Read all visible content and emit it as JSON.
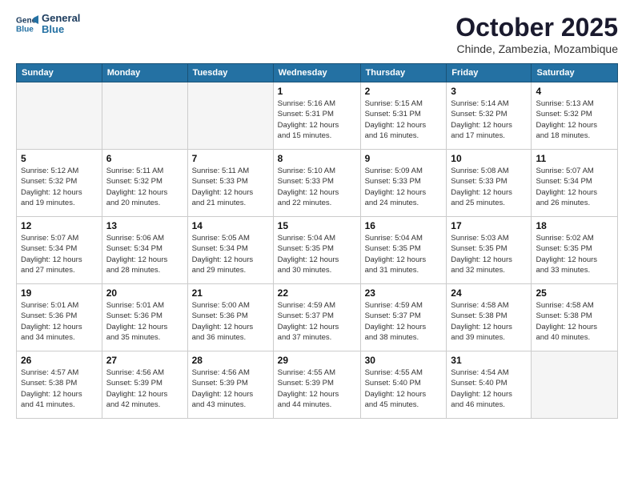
{
  "logo": {
    "line1": "General",
    "line2": "Blue"
  },
  "title": "October 2025",
  "subtitle": "Chinde, Zambezia, Mozambique",
  "weekdays": [
    "Sunday",
    "Monday",
    "Tuesday",
    "Wednesday",
    "Thursday",
    "Friday",
    "Saturday"
  ],
  "weeks": [
    [
      {
        "day": "",
        "info": ""
      },
      {
        "day": "",
        "info": ""
      },
      {
        "day": "",
        "info": ""
      },
      {
        "day": "1",
        "info": "Sunrise: 5:16 AM\nSunset: 5:31 PM\nDaylight: 12 hours\nand 15 minutes."
      },
      {
        "day": "2",
        "info": "Sunrise: 5:15 AM\nSunset: 5:31 PM\nDaylight: 12 hours\nand 16 minutes."
      },
      {
        "day": "3",
        "info": "Sunrise: 5:14 AM\nSunset: 5:32 PM\nDaylight: 12 hours\nand 17 minutes."
      },
      {
        "day": "4",
        "info": "Sunrise: 5:13 AM\nSunset: 5:32 PM\nDaylight: 12 hours\nand 18 minutes."
      }
    ],
    [
      {
        "day": "5",
        "info": "Sunrise: 5:12 AM\nSunset: 5:32 PM\nDaylight: 12 hours\nand 19 minutes."
      },
      {
        "day": "6",
        "info": "Sunrise: 5:11 AM\nSunset: 5:32 PM\nDaylight: 12 hours\nand 20 minutes."
      },
      {
        "day": "7",
        "info": "Sunrise: 5:11 AM\nSunset: 5:33 PM\nDaylight: 12 hours\nand 21 minutes."
      },
      {
        "day": "8",
        "info": "Sunrise: 5:10 AM\nSunset: 5:33 PM\nDaylight: 12 hours\nand 22 minutes."
      },
      {
        "day": "9",
        "info": "Sunrise: 5:09 AM\nSunset: 5:33 PM\nDaylight: 12 hours\nand 24 minutes."
      },
      {
        "day": "10",
        "info": "Sunrise: 5:08 AM\nSunset: 5:33 PM\nDaylight: 12 hours\nand 25 minutes."
      },
      {
        "day": "11",
        "info": "Sunrise: 5:07 AM\nSunset: 5:34 PM\nDaylight: 12 hours\nand 26 minutes."
      }
    ],
    [
      {
        "day": "12",
        "info": "Sunrise: 5:07 AM\nSunset: 5:34 PM\nDaylight: 12 hours\nand 27 minutes."
      },
      {
        "day": "13",
        "info": "Sunrise: 5:06 AM\nSunset: 5:34 PM\nDaylight: 12 hours\nand 28 minutes."
      },
      {
        "day": "14",
        "info": "Sunrise: 5:05 AM\nSunset: 5:34 PM\nDaylight: 12 hours\nand 29 minutes."
      },
      {
        "day": "15",
        "info": "Sunrise: 5:04 AM\nSunset: 5:35 PM\nDaylight: 12 hours\nand 30 minutes."
      },
      {
        "day": "16",
        "info": "Sunrise: 5:04 AM\nSunset: 5:35 PM\nDaylight: 12 hours\nand 31 minutes."
      },
      {
        "day": "17",
        "info": "Sunrise: 5:03 AM\nSunset: 5:35 PM\nDaylight: 12 hours\nand 32 minutes."
      },
      {
        "day": "18",
        "info": "Sunrise: 5:02 AM\nSunset: 5:35 PM\nDaylight: 12 hours\nand 33 minutes."
      }
    ],
    [
      {
        "day": "19",
        "info": "Sunrise: 5:01 AM\nSunset: 5:36 PM\nDaylight: 12 hours\nand 34 minutes."
      },
      {
        "day": "20",
        "info": "Sunrise: 5:01 AM\nSunset: 5:36 PM\nDaylight: 12 hours\nand 35 minutes."
      },
      {
        "day": "21",
        "info": "Sunrise: 5:00 AM\nSunset: 5:36 PM\nDaylight: 12 hours\nand 36 minutes."
      },
      {
        "day": "22",
        "info": "Sunrise: 4:59 AM\nSunset: 5:37 PM\nDaylight: 12 hours\nand 37 minutes."
      },
      {
        "day": "23",
        "info": "Sunrise: 4:59 AM\nSunset: 5:37 PM\nDaylight: 12 hours\nand 38 minutes."
      },
      {
        "day": "24",
        "info": "Sunrise: 4:58 AM\nSunset: 5:38 PM\nDaylight: 12 hours\nand 39 minutes."
      },
      {
        "day": "25",
        "info": "Sunrise: 4:58 AM\nSunset: 5:38 PM\nDaylight: 12 hours\nand 40 minutes."
      }
    ],
    [
      {
        "day": "26",
        "info": "Sunrise: 4:57 AM\nSunset: 5:38 PM\nDaylight: 12 hours\nand 41 minutes."
      },
      {
        "day": "27",
        "info": "Sunrise: 4:56 AM\nSunset: 5:39 PM\nDaylight: 12 hours\nand 42 minutes."
      },
      {
        "day": "28",
        "info": "Sunrise: 4:56 AM\nSunset: 5:39 PM\nDaylight: 12 hours\nand 43 minutes."
      },
      {
        "day": "29",
        "info": "Sunrise: 4:55 AM\nSunset: 5:39 PM\nDaylight: 12 hours\nand 44 minutes."
      },
      {
        "day": "30",
        "info": "Sunrise: 4:55 AM\nSunset: 5:40 PM\nDaylight: 12 hours\nand 45 minutes."
      },
      {
        "day": "31",
        "info": "Sunrise: 4:54 AM\nSunset: 5:40 PM\nDaylight: 12 hours\nand 46 minutes."
      },
      {
        "day": "",
        "info": ""
      }
    ]
  ]
}
